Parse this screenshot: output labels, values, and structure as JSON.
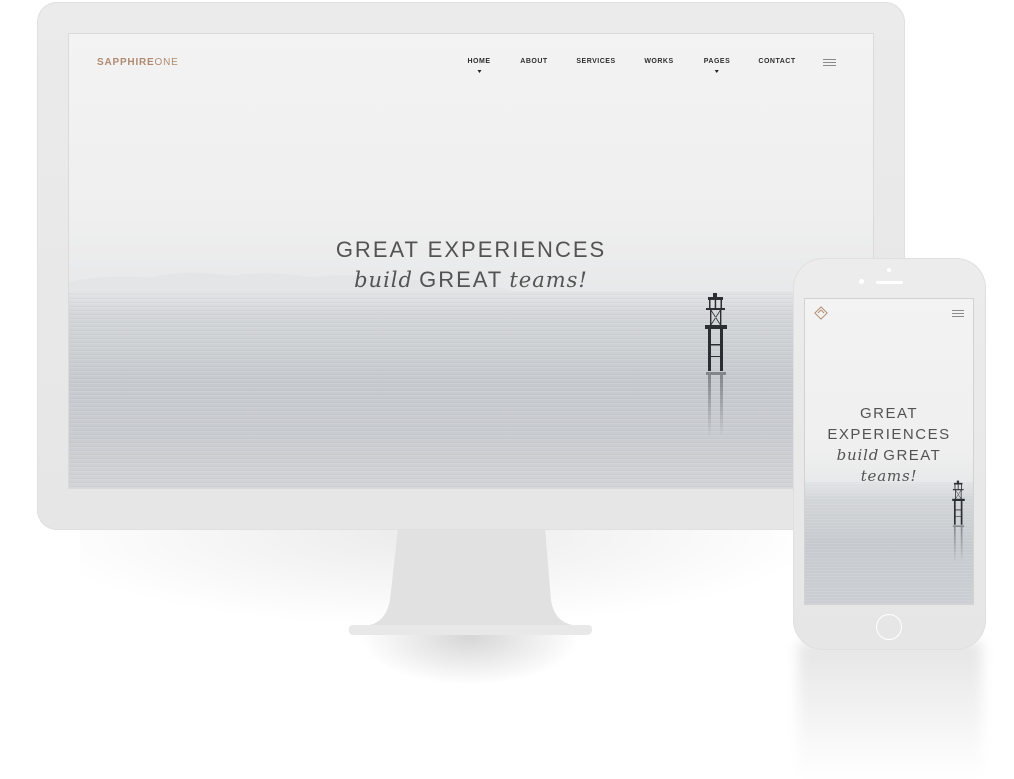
{
  "colors": {
    "brand": "#b08a70",
    "hero_text": "#535353",
    "nav_text": "#2e2e2e"
  },
  "desktop": {
    "logo": {
      "primary": "SAPPHIRE",
      "secondary": "ONE"
    },
    "nav": {
      "items": [
        {
          "label": "HOME",
          "has_dropdown": true
        },
        {
          "label": "ABOUT",
          "has_dropdown": false
        },
        {
          "label": "SERVICES",
          "has_dropdown": false
        },
        {
          "label": "WORKS",
          "has_dropdown": false
        },
        {
          "label": "PAGES",
          "has_dropdown": true
        },
        {
          "label": "CONTACT",
          "has_dropdown": false
        }
      ],
      "menu_icon": "hamburger-icon",
      "dropdown_icon": "caret-down-icon"
    },
    "hero": {
      "line1": "GREAT EXPERIENCES",
      "line2": {
        "word1": "build",
        "word2": "GREAT",
        "word3": "teams!"
      }
    }
  },
  "mobile": {
    "logo_icon": "diamond-logo-icon",
    "menu_icon": "hamburger-icon",
    "hero": {
      "line1": "GREAT",
      "line2": "EXPERIENCES",
      "line3": {
        "word1": "build",
        "word2": "GREAT"
      },
      "line4": "teams!"
    }
  }
}
